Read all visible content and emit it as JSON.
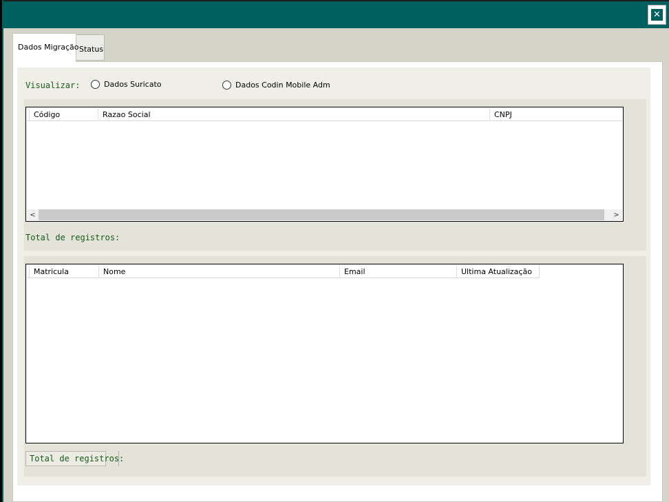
{
  "window": {
    "close_glyph": "✕"
  },
  "tabs": [
    {
      "label": "Dados Migração",
      "active": true
    },
    {
      "label": "Status",
      "active": false
    }
  ],
  "visualizar": {
    "label": "Visualizar:",
    "options": [
      {
        "label": "Dados Suricato",
        "selected": false
      },
      {
        "label": "Dados Codin Mobile Adm",
        "selected": false
      }
    ]
  },
  "empresas_grid": {
    "columns": [
      "Código",
      "Razao Social",
      "CNPJ"
    ],
    "rows": [],
    "scroll_left_glyph": "<",
    "scroll_right_glyph": ">"
  },
  "empresas_total": {
    "label": "Total de registros:"
  },
  "usuarios_grid": {
    "columns": [
      "Matricula",
      "Nome",
      "Email",
      "Ultima Atualização"
    ],
    "rows": []
  },
  "usuarios_total": {
    "label": "Total de registros:"
  },
  "colors": {
    "titlebar": "#005f5f",
    "label_green": "#1a5a1a"
  }
}
